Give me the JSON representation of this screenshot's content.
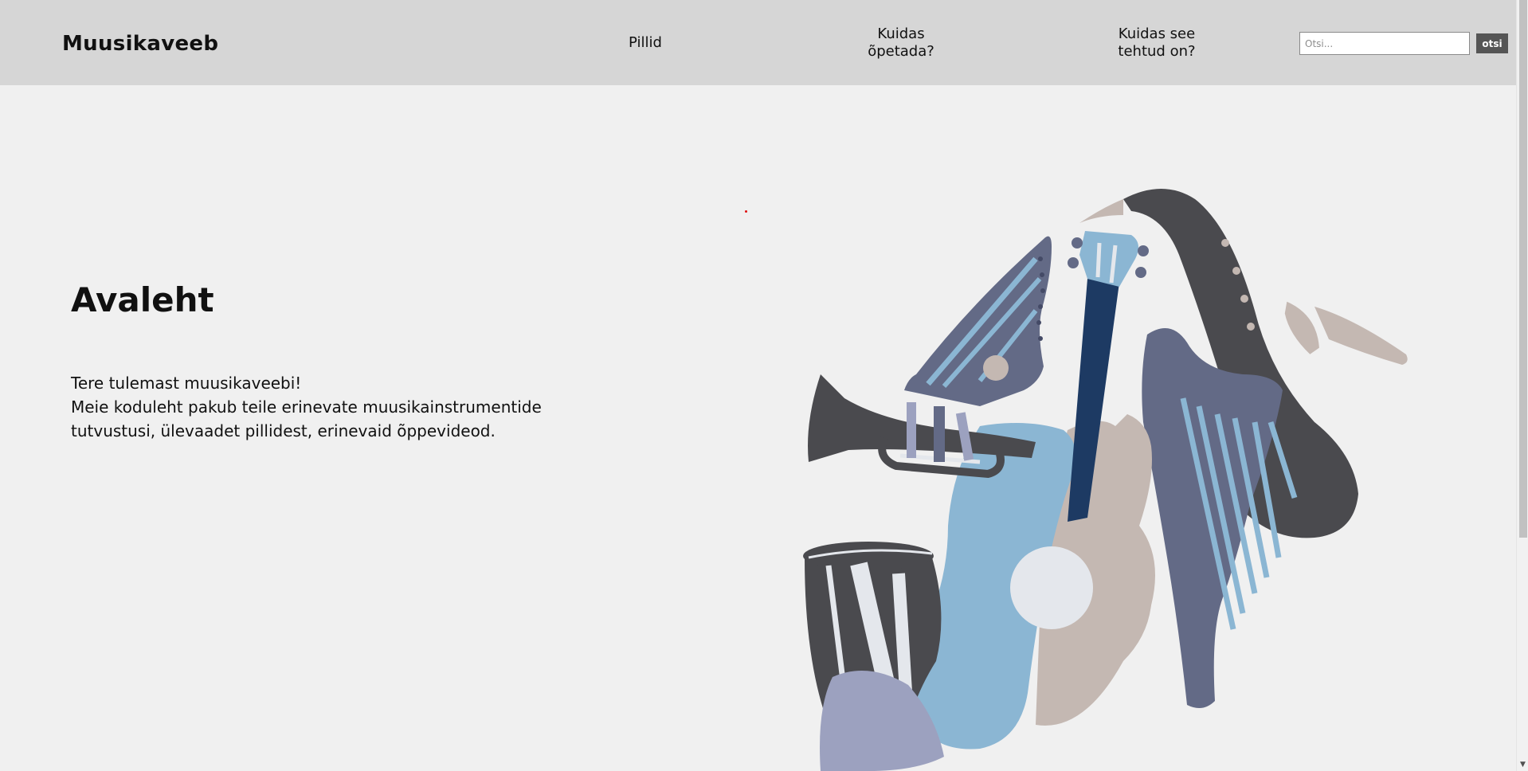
{
  "header": {
    "logo": "Muusikaveeb",
    "nav": {
      "pillid": "Pillid",
      "kuidas_line1": "Kuidas",
      "kuidas_line2": "õpetada?",
      "tehtud_line1": "Kuidas see",
      "tehtud_line2": "tehtud on?"
    },
    "search": {
      "placeholder": "Otsi...",
      "value": "",
      "button_label": "otsi"
    }
  },
  "main": {
    "title": "Avaleht",
    "intro_line1": "Tere tulemast muusikaveebi!",
    "intro_line2": "Meie koduleht pakub teile erinevate muusikainstrumentide tutvustusi, ülevaadet pillidest, erinevaid õppevideod."
  },
  "illustration": {
    "description_icon": "musical-instruments-illustration",
    "colors": {
      "dark_gray": "#4a4a4e",
      "slate": "#636a86",
      "light_blue": "#8bb6d3",
      "navy": "#1d3a63",
      "beige": "#c4b8b2",
      "pale": "#e4e7ec",
      "lavender": "#9ca1bf"
    }
  },
  "colors": {
    "header_bg": "#d6d6d6",
    "page_bg": "#f0f0f0",
    "button_bg": "#555555"
  }
}
